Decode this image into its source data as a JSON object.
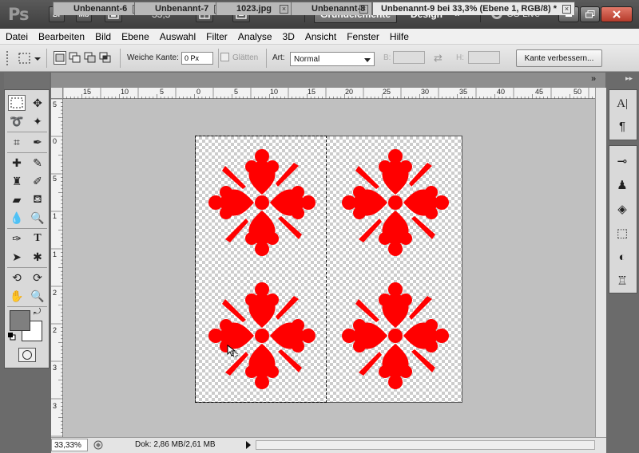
{
  "app": {
    "logo": "Ps",
    "bridge_label": "Br",
    "minibridge_label": "Mb",
    "zoom": "33,3",
    "workspaces": {
      "active": "Grundelemente",
      "other": "Design",
      "more": "»"
    },
    "cs_live": "CS Live"
  },
  "menu": [
    "Datei",
    "Bearbeiten",
    "Bild",
    "Ebene",
    "Auswahl",
    "Filter",
    "Analyse",
    "3D",
    "Ansicht",
    "Fenster",
    "Hilfe"
  ],
  "options": {
    "feather_label": "Weiche Kante:",
    "feather_value": "0 Px",
    "antialias_label": "Glätten",
    "style_label": "Art:",
    "style_value": "Normal",
    "width_label": "B:",
    "height_label": "H:",
    "refine_label": "Kante verbessern..."
  },
  "tabs": [
    {
      "label": "Unbenannt-6",
      "active": false
    },
    {
      "label": "Unbenannt-7",
      "active": false
    },
    {
      "label": "1023.jpg",
      "active": false
    },
    {
      "label": "Unbenannt-8",
      "active": false
    },
    {
      "label": "Unbenannt-9 bei 33,3% (Ebene 1, RGB/8) *",
      "active": true
    }
  ],
  "ruler_top_labels": [
    "15",
    "10",
    "5",
    "0",
    "5",
    "10",
    "15",
    "20",
    "25",
    "30",
    "35",
    "40",
    "45",
    "50"
  ],
  "ruler_left_labels": [
    "5",
    "0",
    "5",
    "1",
    "1",
    "2",
    "2",
    "3",
    "3"
  ],
  "colors": {
    "foreground": "#7f7f7f",
    "background": "#ffffff",
    "flower": "#ff0000"
  },
  "status": {
    "zoom": "33,33%",
    "doc": "Dok: 2,86 MB/2,61 MB"
  }
}
